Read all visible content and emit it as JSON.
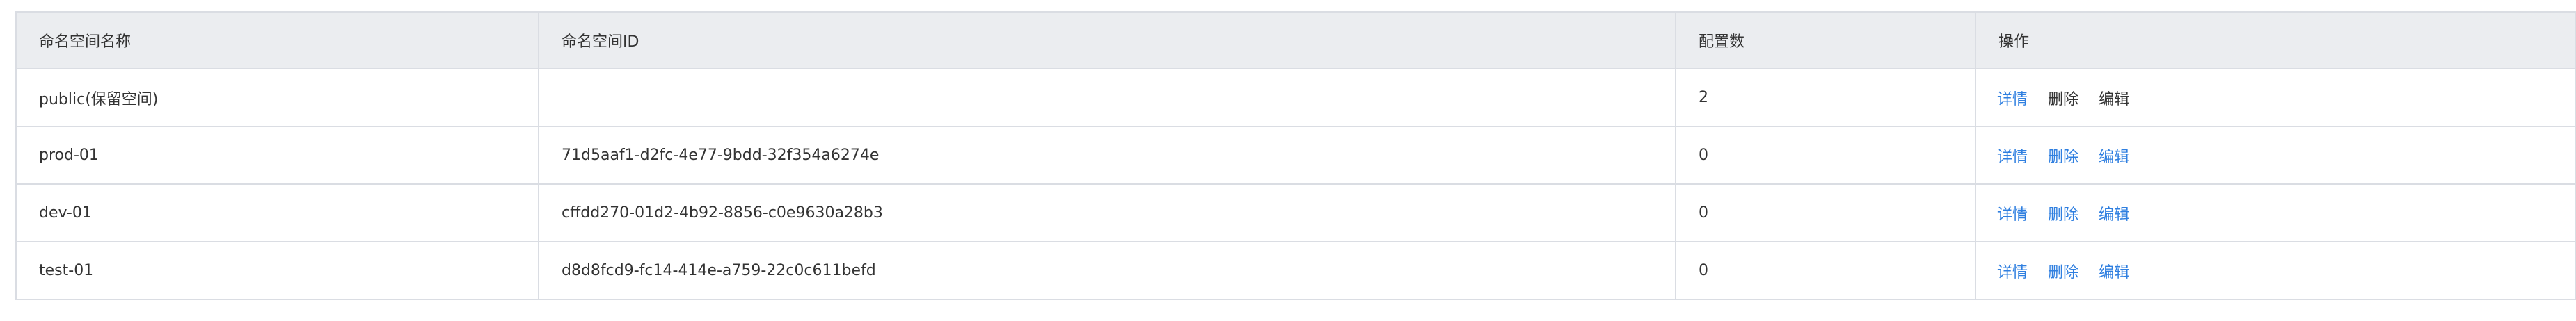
{
  "table": {
    "headers": [
      "命名空间名称",
      "命名空间ID",
      "配置数",
      "操作"
    ],
    "rows": [
      {
        "name": "public(保留空间)",
        "id": "",
        "count": "2",
        "actions": [
          "详情",
          "删除",
          "编辑"
        ]
      },
      {
        "name": "prod-01",
        "id": "71d5aaf1-d2fc-4e77-9bdd-32f354a6274e",
        "count": "0",
        "actions": [
          "详情",
          "删除",
          "编辑"
        ]
      },
      {
        "name": "dev-01",
        "id": "cffdd270-01d2-4b92-8856-c0e9630a28b3",
        "count": "0",
        "actions": [
          "详情",
          "删除",
          "编辑"
        ]
      },
      {
        "name": "test-01",
        "id": "d8d8fcd9-fc14-414e-a759-22c0c611befd",
        "count": "0",
        "actions": [
          "详情",
          "删除",
          "编辑"
        ]
      }
    ]
  },
  "colors": {
    "link": "#2f7fe0",
    "header_bg": "#ebedf0",
    "border": "#dadde3",
    "text": "#333333"
  }
}
